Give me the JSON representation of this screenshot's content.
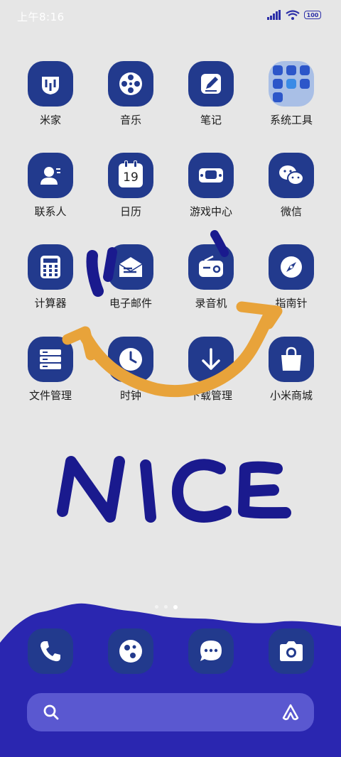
{
  "status_bar": {
    "time": "上午8:16",
    "battery": "100"
  },
  "apps": [
    {
      "label": "米家",
      "icon": "mi-home-icon"
    },
    {
      "label": "音乐",
      "icon": "music-reel-icon"
    },
    {
      "label": "笔记",
      "icon": "notes-pen-icon"
    },
    {
      "label": "系统工具",
      "icon": "system-tools-folder-icon"
    },
    {
      "label": "联系人",
      "icon": "contacts-icon"
    },
    {
      "label": "日历",
      "icon": "calendar-icon",
      "day": "19"
    },
    {
      "label": "游戏中心",
      "icon": "game-controller-icon"
    },
    {
      "label": "微信",
      "icon": "wechat-icon"
    },
    {
      "label": "计算器",
      "icon": "calculator-icon"
    },
    {
      "label": "电子邮件",
      "icon": "email-icon"
    },
    {
      "label": "录音机",
      "icon": "recorder-icon"
    },
    {
      "label": "指南针",
      "icon": "compass-icon"
    },
    {
      "label": "文件管理",
      "icon": "file-manager-icon"
    },
    {
      "label": "时钟",
      "icon": "clock-icon"
    },
    {
      "label": "下载管理",
      "icon": "download-icon"
    },
    {
      "label": "小米商城",
      "icon": "shopping-bag-icon"
    }
  ],
  "dock": [
    "phone-icon",
    "browser-icon",
    "messages-icon",
    "camera-icon"
  ],
  "drawing": {
    "text": "NICE",
    "colors": {
      "ink_blue": "#1a1a8e",
      "smile_orange": "#e8a33a",
      "dock_blue": "#2a26b0"
    }
  },
  "colors": {
    "icon_bg": "#223a8d",
    "folder_bg": "#a9bfe6",
    "search_bar": "#5a58d0",
    "wallpaper": "#e6e6e6"
  }
}
